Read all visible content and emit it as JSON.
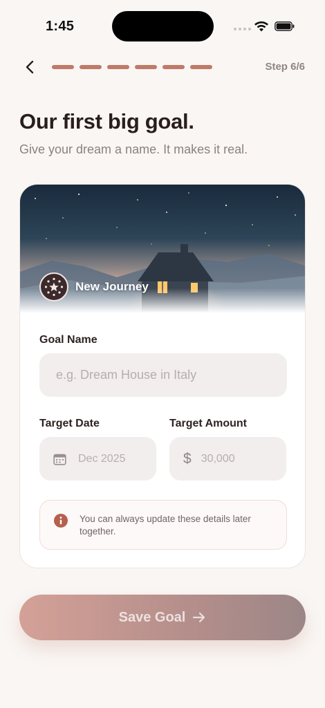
{
  "status_bar": {
    "time": "1:45"
  },
  "nav": {
    "step": "Step 6/6",
    "progress_segments": 6
  },
  "header": {
    "title": "Our first big goal.",
    "subtitle": "Give your dream a name. It makes it real."
  },
  "card": {
    "hero_label": "New Journey",
    "goal_name": {
      "label": "Goal Name",
      "placeholder": "e.g. Dream House in Italy"
    },
    "target_date": {
      "label": "Target Date",
      "placeholder": "Dec 2025"
    },
    "target_amount": {
      "label": "Target Amount",
      "currency": "$",
      "placeholder": "30,000"
    },
    "info": "You can always update these details later together."
  },
  "actions": {
    "save_label": "Save Goal"
  },
  "colors": {
    "accent": "#bf7a69",
    "background": "#f9f6f4",
    "info_icon": "#b5604e"
  },
  "icons": [
    "back-chevron-icon",
    "calendar-icon",
    "dollar-icon",
    "info-icon",
    "arrow-right-icon",
    "star-icon",
    "moon-icon",
    "house-icon"
  ]
}
